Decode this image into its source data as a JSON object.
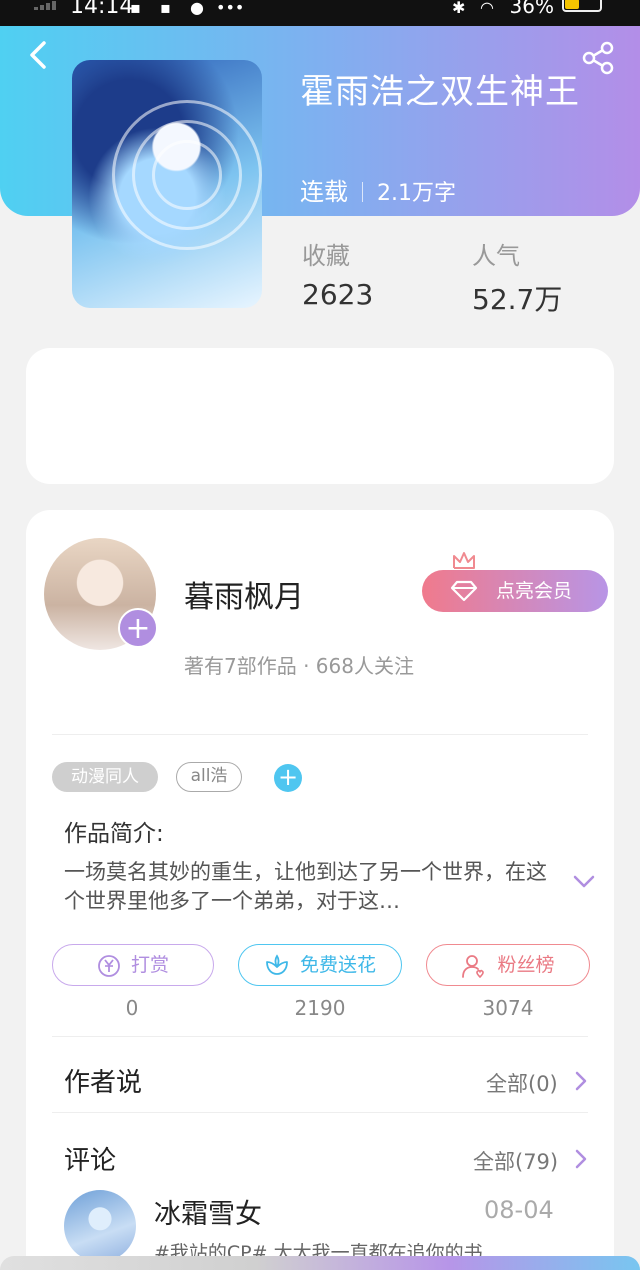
{
  "status_bar": {
    "time": "14:14",
    "battery": "36%"
  },
  "book": {
    "title": "霍雨浩之双生神王",
    "status": "连载",
    "word_count": "2.1万字",
    "stats": [
      {
        "label": "收藏",
        "value": "2623"
      },
      {
        "label": "人气",
        "value": "52.7万"
      }
    ]
  },
  "author": {
    "name": "暮雨枫月",
    "meta": "著有7部作品 · 668人关注",
    "vip_label": "点亮会员"
  },
  "tags": [
    "动漫同人",
    "all浩"
  ],
  "intro": {
    "label": "作品简介:",
    "text": "一场莫名其妙的重生，让他到达了另一个世界，在这个世界里他多了一个弟弟，对于这…"
  },
  "actions": [
    {
      "label": "打赏",
      "count": "0",
      "icon": "yen-icon",
      "color": "#b08ee0"
    },
    {
      "label": "免费送花",
      "count": "2190",
      "icon": "flower-icon",
      "color": "#3fb8e8"
    },
    {
      "label": "粉丝榜",
      "count": "3074",
      "icon": "fan-icon",
      "color": "#ea7a84"
    }
  ],
  "author_says": {
    "title": "作者说",
    "link": "全部(0)"
  },
  "comments": {
    "title": "评论",
    "link": "全部(79)",
    "items": [
      {
        "user": "冰霜雪女",
        "date": "08-04",
        "text": "#我站的CP# 大大我一直都在追你的书"
      }
    ]
  }
}
